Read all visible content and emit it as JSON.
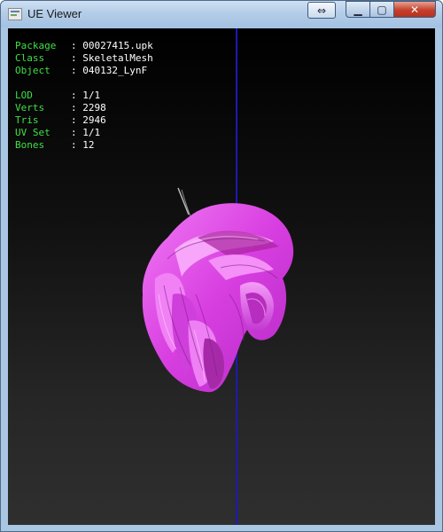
{
  "window": {
    "title": "UE Viewer",
    "extra_button_glyph": "⇔",
    "min_glyph": "▁",
    "max_glyph": "▢",
    "close_glyph": "✕",
    "icon": "app-icon"
  },
  "hud": {
    "package_label": "Package",
    "package_value": "00027415.upk",
    "class_label": "Class",
    "class_value": "SkeletalMesh",
    "object_label": "Object",
    "object_value": "040132_LynF",
    "lod_label": "LOD",
    "lod_value": "1/1",
    "verts_label": "Verts",
    "verts_value": "2298",
    "tris_label": "Tris",
    "tris_value": "2946",
    "uvset_label": "UV Set",
    "uvset_value": "1/1",
    "bones_label": "Bones",
    "bones_value": "12"
  },
  "colors": {
    "label": "#3fe046",
    "value": "#ffffff",
    "axis": "#1a1ab8",
    "mesh": "#e050e8"
  }
}
